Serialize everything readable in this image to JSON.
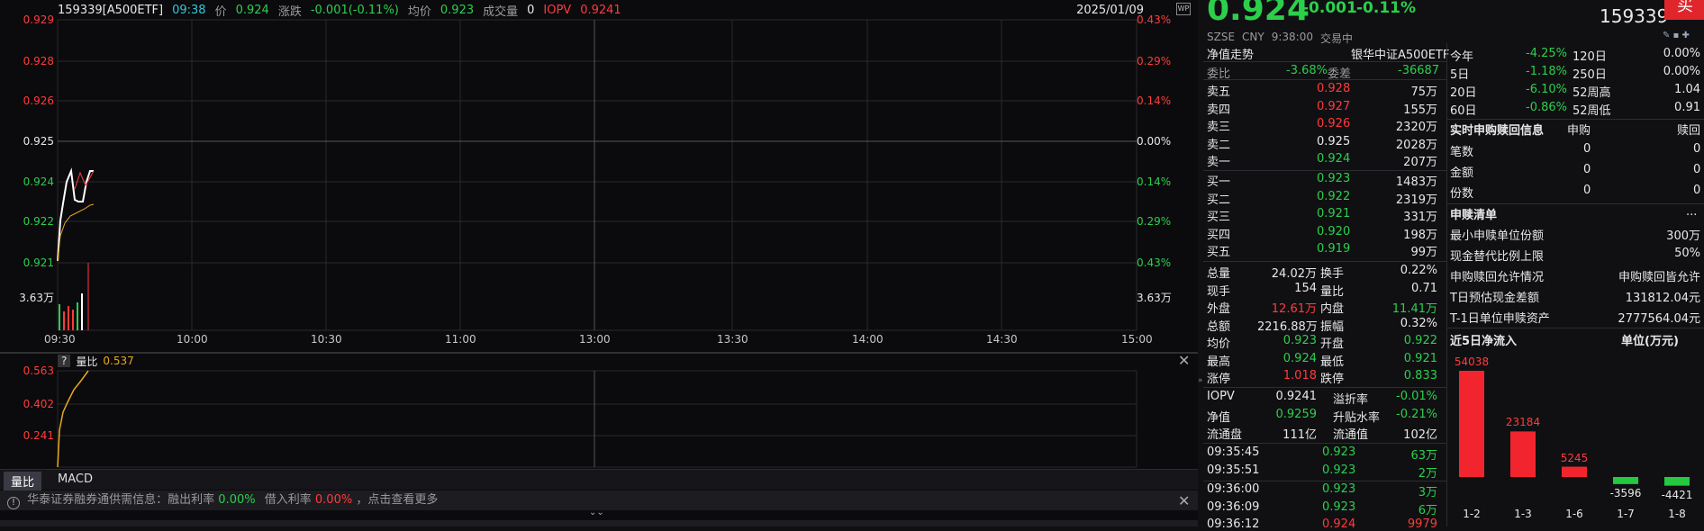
{
  "header": {
    "code": "159339[A500ETF]",
    "time": "09:38",
    "price_label": "价",
    "price": "0.924",
    "change_label": "涨跌",
    "change": "-0.001(-0.11%)",
    "avg_label": "均价",
    "avg": "0.923",
    "vol_label": "成交量",
    "vol": "0",
    "iopv_label": "IOPV",
    "iopv": "0.9241",
    "date": "2025/01/09"
  },
  "yaxis_left": [
    "0.929",
    "0.928",
    "0.926",
    "0.925",
    "0.924",
    "0.922",
    "0.921",
    "3.63万"
  ],
  "yaxis_right": [
    "0.43%",
    "0.29%",
    "0.14%",
    "0.00%",
    "0.14%",
    "0.29%",
    "0.43%",
    "3.63万"
  ],
  "xaxis": [
    "09:30",
    "10:00",
    "10:30",
    "11:00",
    "13:00",
    "13:30",
    "14:00",
    "14:30",
    "15:00"
  ],
  "sub": {
    "help": "?",
    "label": "量比",
    "value": "0.537",
    "yaxis": [
      "0.563",
      "0.402",
      "0.241"
    ]
  },
  "tabs": [
    "量比",
    "MACD"
  ],
  "notice": {
    "prefix": "华泰证券融券通供需信息：融出利率",
    "rate1": "0.00%",
    "mid": "借入利率",
    "rate2": "0.00%",
    "suffix": "，点击查看更多"
  },
  "quote": {
    "price": "0.924",
    "chg": "-0.001",
    "pct": "-0.11%",
    "code": "159339",
    "btn": "买",
    "market": "SZSE",
    "cur": "CNY",
    "qtime": "9:38:00",
    "status": "交易中"
  },
  "nav": {
    "title": "净值走势",
    "name": "银华中证A500ETF"
  },
  "wb": {
    "l1": "委比",
    "v1": "-3.68%",
    "l2": "委差",
    "v2": "-36687"
  },
  "asks": [
    {
      "l": "卖五",
      "p": "0.928",
      "v": "75万"
    },
    {
      "l": "卖四",
      "p": "0.927",
      "v": "155万"
    },
    {
      "l": "卖三",
      "p": "0.926",
      "v": "2320万"
    },
    {
      "l": "卖二",
      "p": "0.925",
      "v": "2028万"
    },
    {
      "l": "卖一",
      "p": "0.924",
      "v": "207万"
    }
  ],
  "bids": [
    {
      "l": "买一",
      "p": "0.923",
      "v": "1483万"
    },
    {
      "l": "买二",
      "p": "0.922",
      "v": "2319万"
    },
    {
      "l": "买三",
      "p": "0.921",
      "v": "331万"
    },
    {
      "l": "买四",
      "p": "0.920",
      "v": "198万"
    },
    {
      "l": "买五",
      "p": "0.919",
      "v": "99万"
    }
  ],
  "stats": [
    [
      "总量",
      "24.02万",
      "换手",
      "0.22%"
    ],
    [
      "现手",
      "154",
      "量比",
      "0.71"
    ],
    [
      "外盘",
      "12.61万",
      "内盘",
      "11.41万"
    ],
    [
      "总额",
      "2216.88万",
      "振幅",
      "0.32%"
    ],
    [
      "均价",
      "0.923",
      "开盘",
      "0.922"
    ],
    [
      "最高",
      "0.924",
      "最低",
      "0.921"
    ],
    [
      "涨停",
      "1.018",
      "跌停",
      "0.833"
    ]
  ],
  "stats2": [
    [
      "IOPV",
      "0.9241",
      "溢折率",
      "-0.01%"
    ],
    [
      "净值",
      "0.9259",
      "升贴水率",
      "-0.21%"
    ],
    [
      "流通盘",
      "111亿",
      "流通值",
      "102亿"
    ]
  ],
  "ticks": [
    [
      "09:35:45",
      "0.923",
      "63万"
    ],
    [
      "09:35:51",
      "0.923",
      "2万"
    ],
    [
      "09:36:00",
      "0.923",
      "3万"
    ],
    [
      "09:36:09",
      "0.923",
      "6万"
    ],
    [
      "09:36:12",
      "0.924",
      "9979"
    ]
  ],
  "perf": [
    [
      "今年",
      "-4.25%",
      "120日",
      "0.00%"
    ],
    [
      "5日",
      "-1.18%",
      "250日",
      "0.00%"
    ],
    [
      "20日",
      "-6.10%",
      "52周高",
      "1.04"
    ],
    [
      "60日",
      "-0.86%",
      "52周低",
      "0.91"
    ]
  ],
  "sg": {
    "title": "实时申购赎回信息",
    "buy": "申购",
    "sell": "赎回",
    "rows": [
      [
        "笔数",
        "0",
        "0"
      ],
      [
        "金额",
        "0",
        "0"
      ],
      [
        "份数",
        "0",
        "0"
      ]
    ]
  },
  "list": {
    "title": "申赎清单",
    "more": "...",
    "rows": [
      [
        "最小申赎单位份额",
        "300万"
      ],
      [
        "现金替代比例上限",
        "50%"
      ],
      [
        "申购赎回允许情况",
        "申购赎回皆允许"
      ],
      [
        "T日预估现金差额",
        "131812.04元"
      ],
      [
        "T-1日单位申赎资产",
        "2777564.04元"
      ]
    ]
  },
  "flow": {
    "title": "近5日净流入",
    "unit": "单位(万元)"
  },
  "chart_data": {
    "type": "bar",
    "categories": [
      "1-2",
      "1-3",
      "1-6",
      "1-7",
      "1-8"
    ],
    "values": [
      54038,
      23184,
      5245,
      -3596,
      -4421
    ],
    "title": "近5日净流入",
    "ylabel": "单位(万元)"
  }
}
